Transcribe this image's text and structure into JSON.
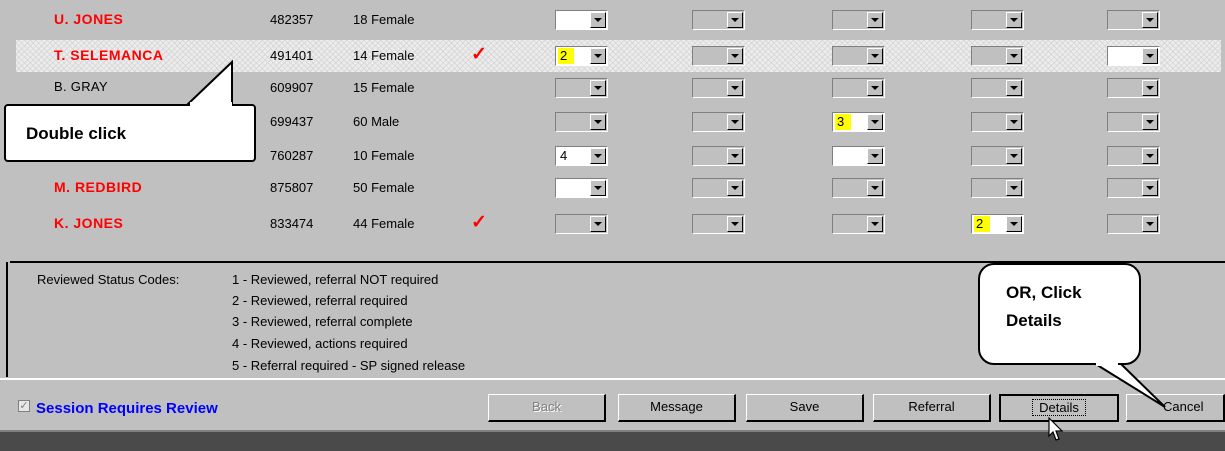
{
  "rows": [
    {
      "name": "U. JONES",
      "red": true,
      "id": "482357",
      "age_sex": "18 Female",
      "checked": false,
      "dropdowns": [
        {
          "value": "",
          "style": "white"
        },
        {
          "value": "",
          "style": "grey"
        },
        {
          "value": "",
          "style": "grey"
        },
        {
          "value": "",
          "style": "grey"
        },
        {
          "value": "",
          "style": "grey"
        }
      ]
    },
    {
      "name": "T. SELEMANCA",
      "red": true,
      "id": "491401",
      "age_sex": "14 Female",
      "checked": true,
      "selected": true,
      "dropdowns": [
        {
          "value": "2",
          "style": "yellow"
        },
        {
          "value": "",
          "style": "grey"
        },
        {
          "value": "",
          "style": "grey"
        },
        {
          "value": "",
          "style": "grey"
        },
        {
          "value": "",
          "style": "white"
        }
      ]
    },
    {
      "name": "B. GRAY",
      "red": false,
      "id": "609907",
      "age_sex": "15 Female",
      "checked": false,
      "dropdowns": [
        {
          "value": "",
          "style": "grey"
        },
        {
          "value": "",
          "style": "grey"
        },
        {
          "value": "",
          "style": "grey"
        },
        {
          "value": "",
          "style": "grey"
        },
        {
          "value": "",
          "style": "grey"
        }
      ]
    },
    {
      "name": "",
      "red": false,
      "id": "699437",
      "age_sex": "60 Male",
      "checked": false,
      "dropdowns": [
        {
          "value": "",
          "style": "grey"
        },
        {
          "value": "",
          "style": "grey"
        },
        {
          "value": "3",
          "style": "yellow"
        },
        {
          "value": "",
          "style": "grey"
        },
        {
          "value": "",
          "style": "grey"
        }
      ]
    },
    {
      "name": "",
      "red": false,
      "id": "760287",
      "age_sex": "10 Female",
      "checked": false,
      "dropdowns": [
        {
          "value": "4",
          "style": "white"
        },
        {
          "value": "",
          "style": "grey"
        },
        {
          "value": "",
          "style": "white"
        },
        {
          "value": "",
          "style": "grey"
        },
        {
          "value": "",
          "style": "grey"
        }
      ]
    },
    {
      "name": "M. REDBIRD",
      "red": true,
      "id": "875807",
      "age_sex": "50 Female",
      "checked": false,
      "dropdowns": [
        {
          "value": "",
          "style": "white"
        },
        {
          "value": "",
          "style": "grey"
        },
        {
          "value": "",
          "style": "grey"
        },
        {
          "value": "",
          "style": "grey"
        },
        {
          "value": "",
          "style": "grey"
        }
      ]
    },
    {
      "name": "K. JONES",
      "red": true,
      "id": "833474",
      "age_sex": "44 Female",
      "checked": true,
      "dropdowns": [
        {
          "value": "",
          "style": "grey"
        },
        {
          "value": "",
          "style": "grey"
        },
        {
          "value": "",
          "style": "grey"
        },
        {
          "value": "2",
          "style": "yellow"
        },
        {
          "value": "",
          "style": "grey"
        }
      ]
    }
  ],
  "check_glyph": "✓",
  "legend": {
    "title": "Reviewed Status Codes:",
    "codes": [
      "1 - Reviewed, referral NOT required",
      "2 - Reviewed, referral required",
      "3 - Reviewed, referral complete",
      "4 - Reviewed, actions required",
      "5 - Referral required - SP signed release"
    ]
  },
  "session_review": {
    "label": "Session Requires Review",
    "checked": true,
    "color": "#0000ff"
  },
  "buttons": {
    "back": "Back",
    "message": "Message",
    "save": "Save",
    "referral": "Referral",
    "details": "Details",
    "cancel": "Cancel"
  },
  "callouts": {
    "double_click": "Double click",
    "or": "OR",
    "click_details_1": ", Click",
    "click_details_2": "Details"
  },
  "colors": {
    "name_red": "#ff0000",
    "highlight_yellow": "#ffff00",
    "window_grey": "#c0c0c0"
  }
}
